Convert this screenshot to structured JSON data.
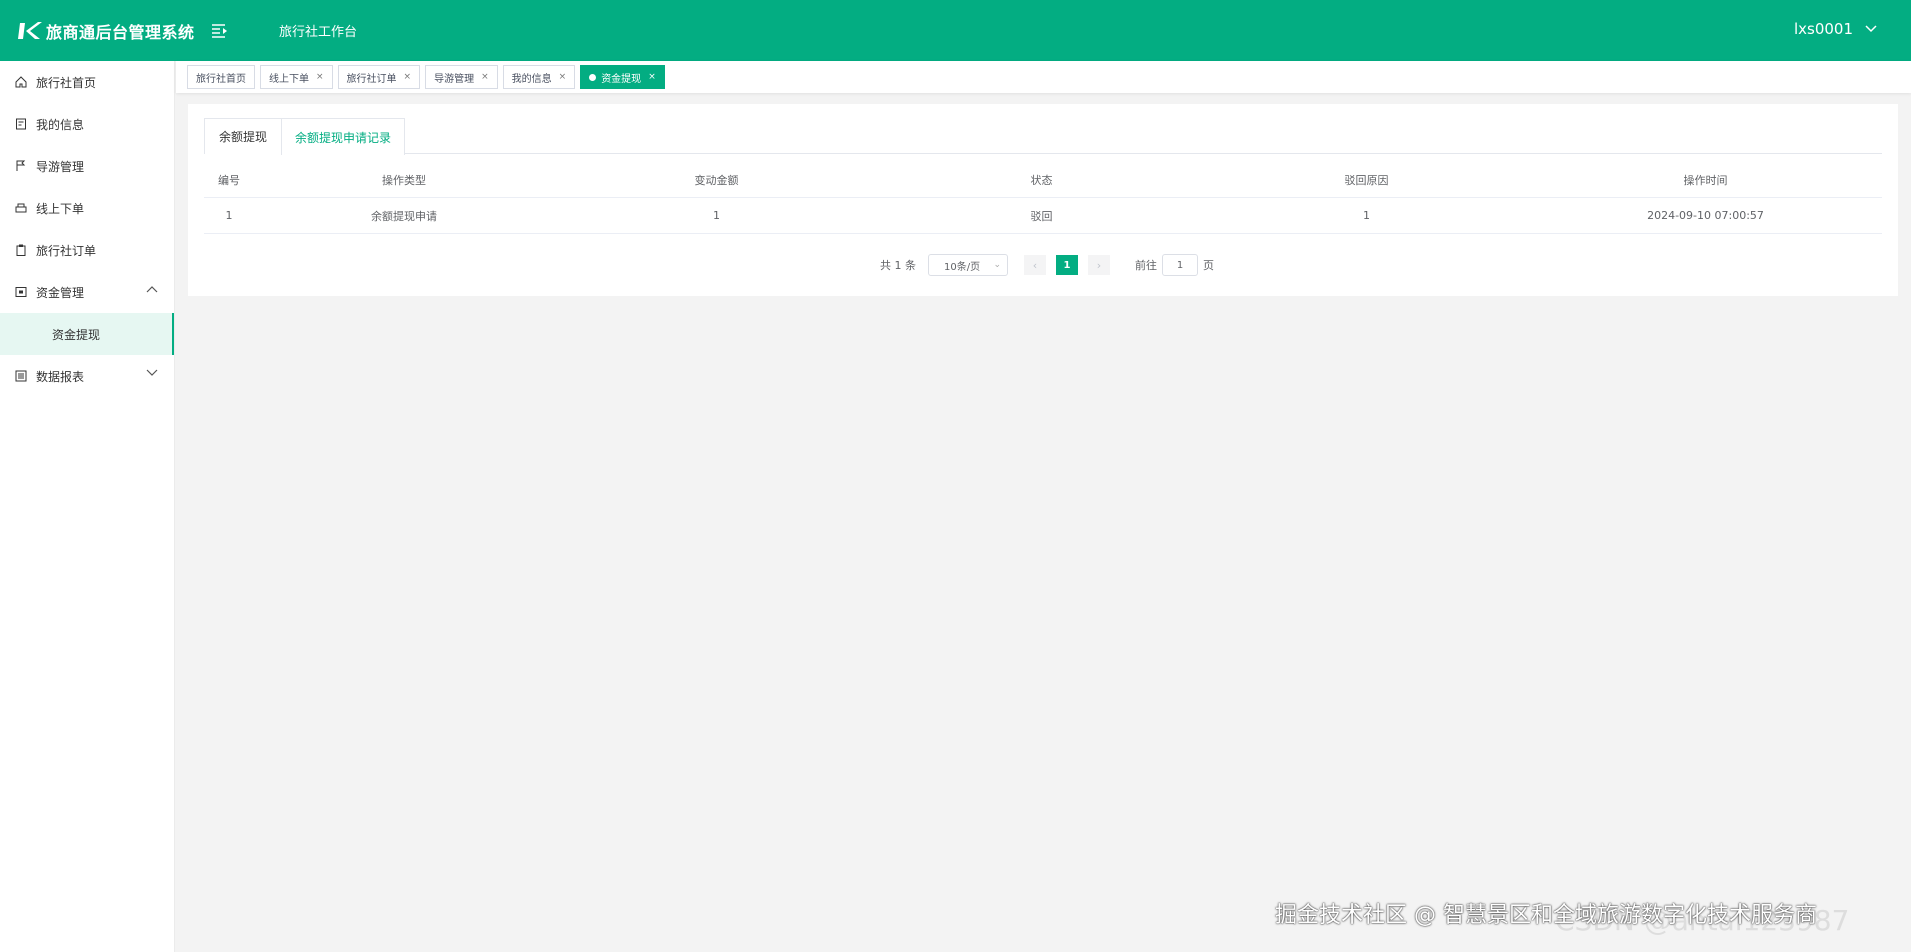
{
  "header": {
    "system_title": "旅商通后台管理系统",
    "workbench": "旅行社工作台",
    "username": "lxs0001"
  },
  "colors": {
    "primary": "#03ad82"
  },
  "sidebar": {
    "items": [
      {
        "label": "旅行社首页",
        "icon": "home-icon"
      },
      {
        "label": "我的信息",
        "icon": "profile-icon"
      },
      {
        "label": "导游管理",
        "icon": "flag-icon"
      },
      {
        "label": "线上下单",
        "icon": "cart-icon"
      },
      {
        "label": "旅行社订单",
        "icon": "clipboard-icon"
      },
      {
        "label": "资金管理",
        "icon": "wallet-icon",
        "expanded": true
      },
      {
        "label": "数据报表",
        "icon": "report-icon",
        "expanded": false
      }
    ],
    "sub_items": {
      "funds": [
        {
          "label": "资金提现",
          "active": true
        }
      ]
    }
  },
  "tags": [
    {
      "label": "旅行社首页",
      "closable": false
    },
    {
      "label": "线上下单",
      "closable": true
    },
    {
      "label": "旅行社订单",
      "closable": true
    },
    {
      "label": "导游管理",
      "closable": true
    },
    {
      "label": "我的信息",
      "closable": true
    },
    {
      "label": "资金提现",
      "closable": true,
      "active": true
    }
  ],
  "tabs": [
    {
      "label": "余额提现"
    },
    {
      "label": "余额提现申请记录",
      "active": true
    }
  ],
  "table": {
    "columns": [
      "编号",
      "操作类型",
      "变动金额",
      "状态",
      "驳回原因",
      "操作时间"
    ],
    "rows": [
      [
        "1",
        "余额提现申请",
        "1",
        "驳回",
        "1",
        "2024-09-10 07:00:57"
      ]
    ]
  },
  "pagination": {
    "total": "共 1 条",
    "page_size": "10条/页",
    "prev": "‹",
    "next": "›",
    "current_page": "1",
    "goto_label": "前往",
    "goto_value": "1",
    "page_unit": "页"
  },
  "watermark": {
    "text": "掘金技术社区 @ 智慧景区和全域旅游数字化技术服务商",
    "faint_text": "CSDN @antai123987"
  }
}
